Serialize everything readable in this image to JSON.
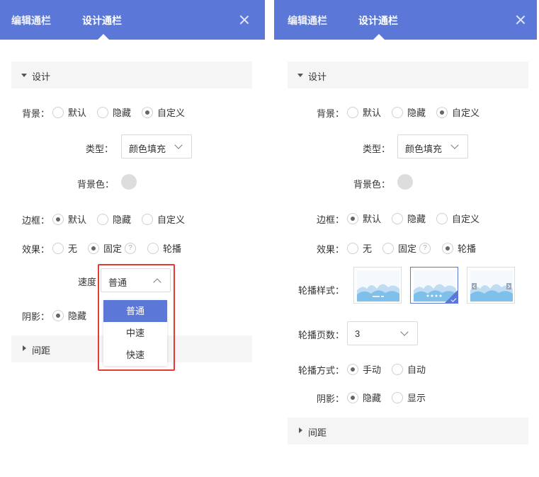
{
  "tabs": {
    "edit": "编辑通栏",
    "design": "设计通栏"
  },
  "left": {
    "section_design": "设计",
    "background": {
      "label": "背景：",
      "options": [
        "默认",
        "隐藏",
        "自定义"
      ]
    },
    "type": {
      "label": "类型：",
      "value": "颜色填充"
    },
    "bgcolor": {
      "label": "背景色：",
      "color": "#dddddd"
    },
    "border": {
      "label": "边框：",
      "options": [
        "默认",
        "隐藏",
        "自定义"
      ]
    },
    "effect": {
      "label": "效果：",
      "options": [
        "无",
        "固定",
        "轮播"
      ],
      "help": "?"
    },
    "speed": {
      "label": "速度",
      "value": "普通",
      "menu": [
        "普通",
        "中速",
        "快速"
      ]
    },
    "shadow": {
      "label": "阴影：",
      "options": [
        "隐藏"
      ]
    },
    "section_spacing": "间距"
  },
  "right": {
    "section_design": "设计",
    "background": {
      "label": "背景：",
      "options": [
        "默认",
        "隐藏",
        "自定义"
      ]
    },
    "type": {
      "label": "类型：",
      "value": "颜色填充"
    },
    "bgcolor": {
      "label": "背景色：",
      "color": "#dddddd"
    },
    "border": {
      "label": "边框：",
      "options": [
        "默认",
        "隐藏",
        "自定义"
      ]
    },
    "effect": {
      "label": "效果：",
      "options": [
        "无",
        "固定",
        "轮播"
      ],
      "help": "?"
    },
    "carousel_style": {
      "label": "轮播样式："
    },
    "carousel_pages": {
      "label": "轮播页数：",
      "value": "3"
    },
    "carousel_mode": {
      "label": "轮播方式：",
      "options": [
        "手动",
        "自动"
      ]
    },
    "shadow": {
      "label": "阴影：",
      "options": [
        "隐藏",
        "显示"
      ]
    },
    "section_spacing": "间距"
  },
  "colors": {
    "accent": "#5b78d8",
    "highlight": "#e53935"
  }
}
